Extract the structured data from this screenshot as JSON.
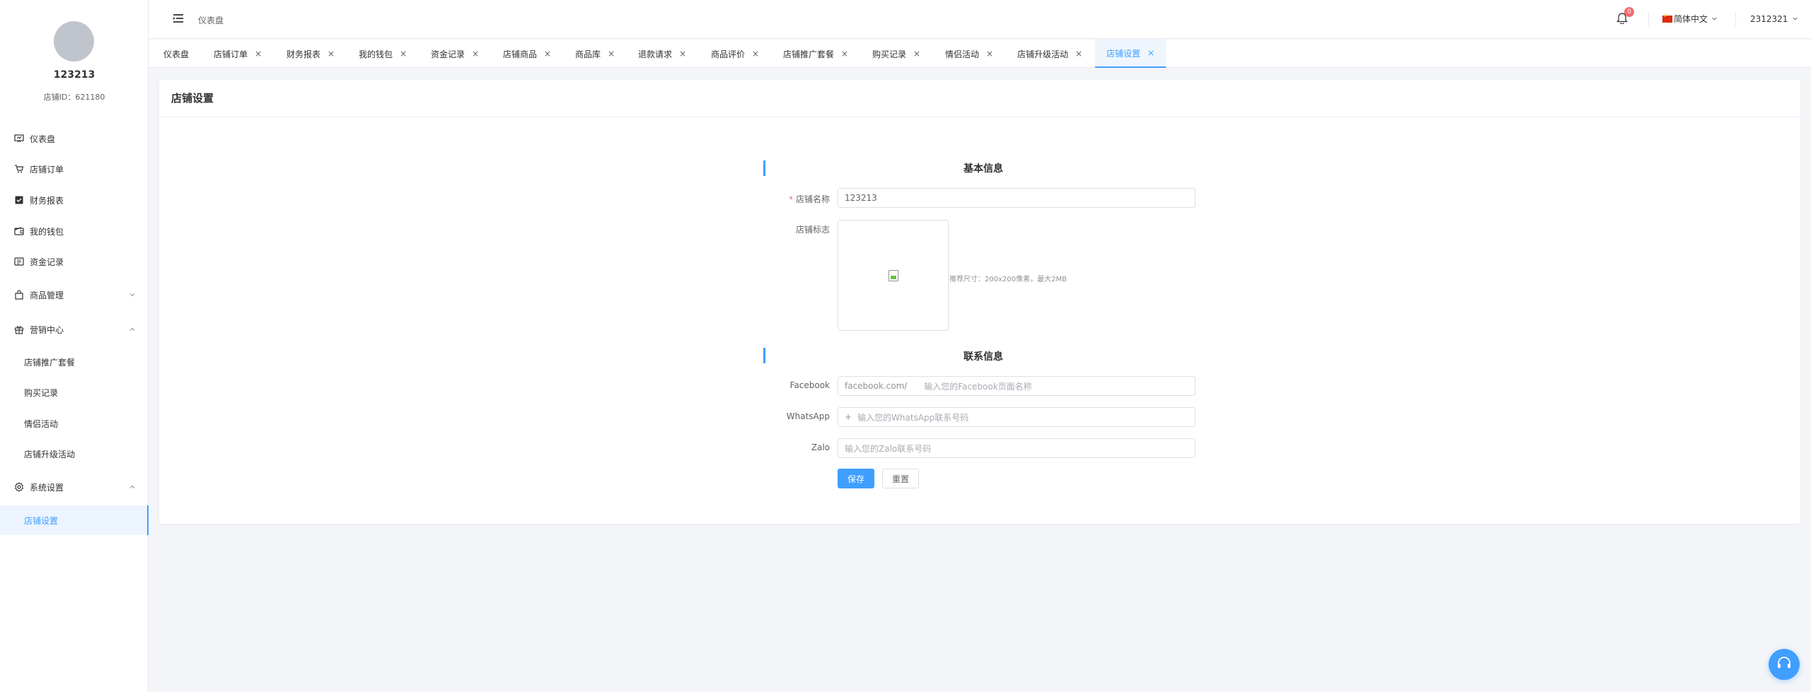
{
  "sidebar": {
    "shop_name": "123213",
    "shop_id": "店铺ID：621180",
    "items": [
      {
        "label": "仪表盘",
        "icon": "dashboard-icon"
      },
      {
        "label": "店铺订单",
        "icon": "cart-icon"
      },
      {
        "label": "财务报表",
        "icon": "report-icon"
      },
      {
        "label": "我的钱包",
        "icon": "wallet-icon"
      },
      {
        "label": "资金记录",
        "icon": "fund-record-icon"
      },
      {
        "label": "商品管理",
        "icon": "goods-icon"
      },
      {
        "label": "营销中心",
        "icon": "gift-icon"
      },
      {
        "label": "店铺推广套餐"
      },
      {
        "label": "购买记录"
      },
      {
        "label": "情侣活动"
      },
      {
        "label": "店铺升级活动"
      },
      {
        "label": "系统设置",
        "icon": "gear-icon"
      },
      {
        "label": "店铺设置"
      }
    ]
  },
  "header": {
    "breadcrumb": "仪表盘",
    "notification_count": "0",
    "language": "简体中文",
    "username": "2312321"
  },
  "tabs": [
    {
      "label": "仪表盘"
    },
    {
      "label": "店铺订单"
    },
    {
      "label": "财务报表"
    },
    {
      "label": "我的钱包"
    },
    {
      "label": "资金记录"
    },
    {
      "label": "店铺商品"
    },
    {
      "label": "商品库"
    },
    {
      "label": "退款请求"
    },
    {
      "label": "商品评价"
    },
    {
      "label": "店铺推广套餐"
    },
    {
      "label": "购买记录"
    },
    {
      "label": "情侣活动"
    },
    {
      "label": "店铺升级活动"
    },
    {
      "label": "店铺设置"
    }
  ],
  "tab_close": "×",
  "page": {
    "title": "店铺设置",
    "basic_section": "基本信息",
    "shop_name_required_mark": "*",
    "shop_name_label": "店铺名称",
    "shop_name_value": "123213",
    "shop_logo_label": "店铺标志",
    "logo_hint": "推荐尺寸：200x200像素，最大2MB",
    "contact_section": "联系信息",
    "facebook_label": "Facebook",
    "facebook_prefix": "facebook.com/",
    "facebook_placeholder": "输入您的Facebook页面名称",
    "whatsapp_label": "WhatsApp",
    "whatsapp_prefix": "+",
    "whatsapp_placeholder": "输入您的WhatsApp联系号码",
    "zalo_label": "Zalo",
    "zalo_placeholder": "输入您的Zalo联系号码",
    "save_button": "保存",
    "reset_button": "重置"
  },
  "colors": {
    "accent": "#409eff",
    "badge": "#f56c6c",
    "background": "#f4f5f9"
  }
}
